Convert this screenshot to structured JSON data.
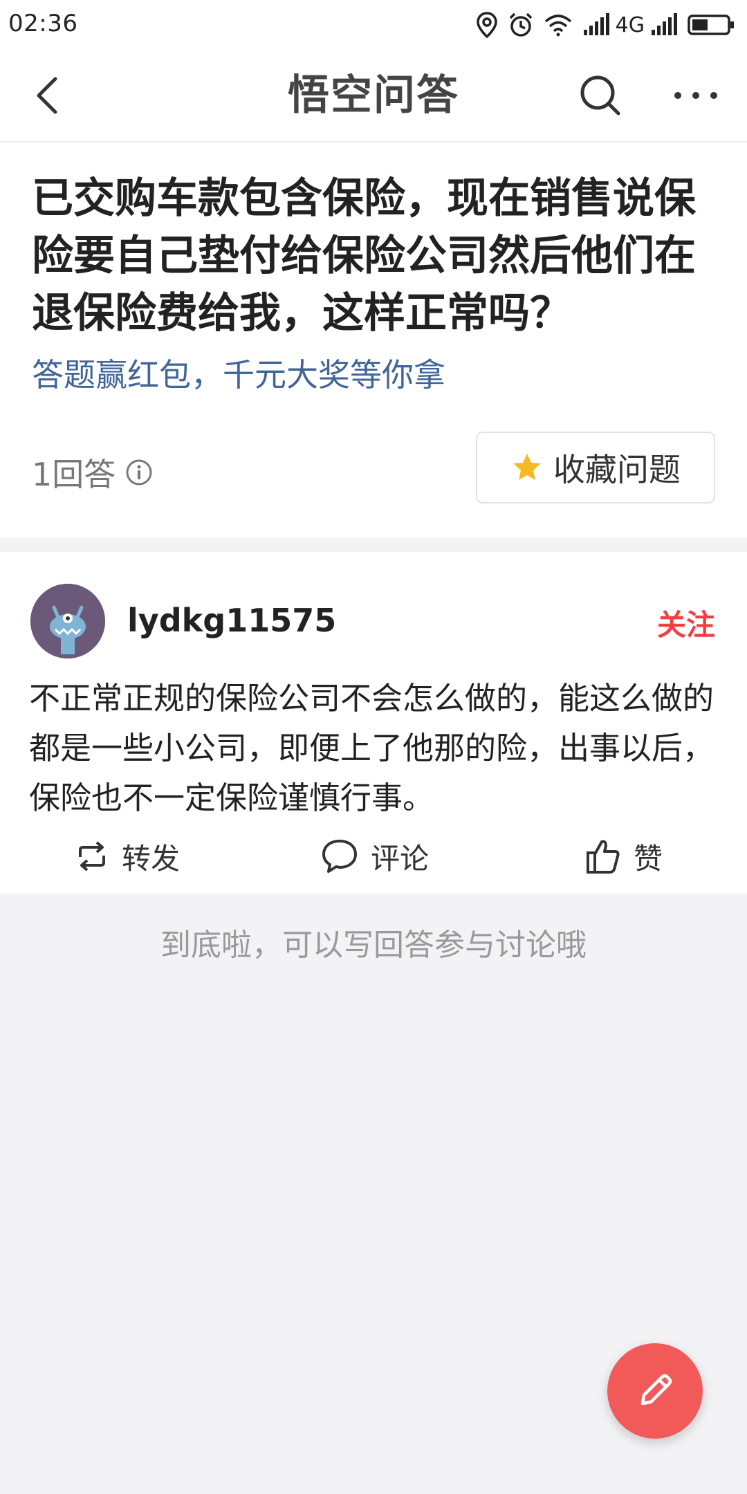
{
  "status_bar": {
    "time": "02:36",
    "network": "4G",
    "icons": [
      "location-icon",
      "alarm-icon",
      "wifi-icon",
      "signal-icon",
      "signal-icon",
      "battery-icon"
    ]
  },
  "nav": {
    "title": "悟空问答",
    "back_icon": "back-arrow-icon",
    "search_icon": "search-icon",
    "more_icon": "more-icon"
  },
  "question": {
    "title": "已交购车款包含保险，现在销售说保险要自己垫付给保险公司然后他们在退保险费给我，这样正常吗？",
    "promo": "答题赢红包，千元大奖等你拿",
    "answer_count": "1回答",
    "favorite_label": "收藏问题"
  },
  "answer": {
    "author": "lydkg11575",
    "follow_label": "关注",
    "content": "不正常正规的保险公司不会怎么做的，能这么做的都是一些小公司，即便上了他那的险，出事以后，保险也不一定保险谨慎行事。",
    "actions": {
      "share": "转发",
      "comment": "评论",
      "like": "赞"
    }
  },
  "footer_hint": "到底啦，可以写回答参与讨论哦",
  "colors": {
    "accent_red": "#f04142",
    "link_blue": "#406599",
    "fab": "#f25a5a",
    "star": "#f5b922"
  }
}
